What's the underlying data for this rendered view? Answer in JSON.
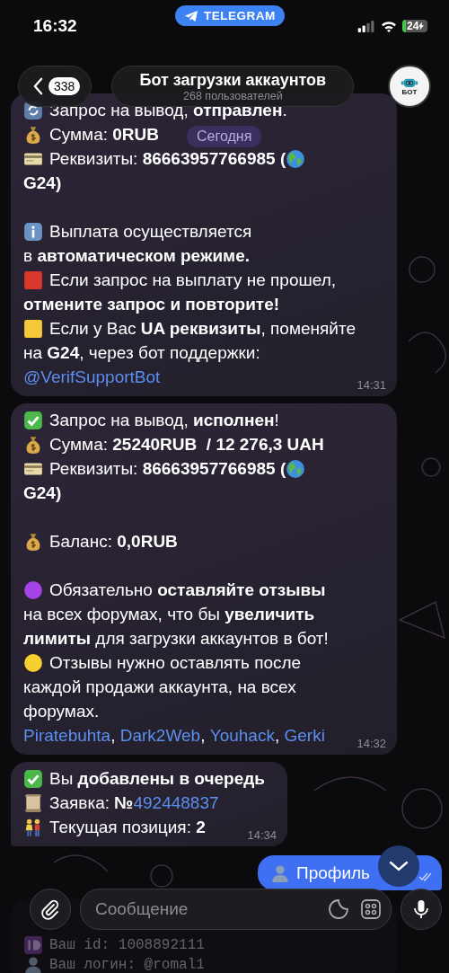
{
  "status_bar": {
    "time": "16:32",
    "app_pill": "TELEGRAM",
    "battery": "24"
  },
  "header": {
    "back_count": "338",
    "title": "Бот загрузки аккаунтов",
    "subtitle": "268 пользователей",
    "avatar_label": "БОТ"
  },
  "date_pill": "Сегодня",
  "messages": [
    {
      "kind": "incoming",
      "time": "14:31",
      "rows": [
        {
          "kind": "sync",
          "parts": [
            {
              "kind": "text",
              "text": "Запрос на вывод, **отправлен**."
            }
          ]
        },
        {
          "kind": "money",
          "parts": [
            {
              "kind": "text",
              "text": "Сумма: **0RUB**"
            }
          ]
        },
        {
          "kind": "card",
          "parts": [
            {
              "kind": "text",
              "text": "Реквизиты: **86663957766985 (**"
            },
            {
              "kind": "globe"
            }
          ]
        },
        {
          "parts": [
            {
              "kind": "text",
              "text": "**G24)**"
            }
          ]
        },
        {
          "kind": "info",
          "spaced": true,
          "parts": [
            {
              "kind": "text",
              "text": "Выплата осуществляется"
            }
          ]
        },
        {
          "parts": [
            {
              "kind": "text",
              "text": "в **автоматическом режиме.**"
            }
          ]
        },
        {
          "kind": "red-square",
          "parts": [
            {
              "kind": "text",
              "text": "Если запрос на выплату не прошел,"
            }
          ]
        },
        {
          "parts": [
            {
              "kind": "text",
              "text": "**отмените запрос и повторите!**"
            }
          ]
        },
        {
          "kind": "yellow-square",
          "parts": [
            {
              "kind": "text",
              "text": "Если у Вас **UA реквизиты**, поменяйте"
            }
          ]
        },
        {
          "parts": [
            {
              "kind": "text",
              "text": "на **G24**, через бот поддержки:"
            }
          ]
        },
        {
          "parts": [
            {
              "kind": "link",
              "text": "@VerifSupportBot"
            }
          ]
        }
      ]
    },
    {
      "kind": "incoming",
      "time": "14:32",
      "rows": [
        {
          "kind": "check",
          "parts": [
            {
              "kind": "text",
              "text": "Запрос на вывод, **исполнен**!"
            }
          ]
        },
        {
          "kind": "money",
          "parts": [
            {
              "kind": "text",
              "text": "Сумма: **25240RUB  / 12 276,3 UAH**"
            }
          ]
        },
        {
          "kind": "card",
          "parts": [
            {
              "kind": "text",
              "text": "Реквизиты: **86663957766985 (**"
            },
            {
              "kind": "globe"
            }
          ]
        },
        {
          "parts": [
            {
              "kind": "text",
              "text": "**G24)**"
            }
          ]
        },
        {
          "kind": "money",
          "spaced": true,
          "parts": [
            {
              "kind": "text",
              "text": "Баланс: **0,0RUB**"
            }
          ]
        },
        {
          "kind": "purple-circle",
          "spaced": true,
          "parts": [
            {
              "kind": "text",
              "text": "Обязательно **оставляйте отзывы**"
            }
          ]
        },
        {
          "parts": [
            {
              "kind": "text",
              "text": "на всех форумах, что бы **увеличить**"
            }
          ]
        },
        {
          "parts": [
            {
              "kind": "text",
              "text": "**лимиты** для загрузки аккаунтов в бот!"
            }
          ]
        },
        {
          "kind": "yellow-circle",
          "parts": [
            {
              "kind": "text",
              "text": "Отзывы нужно оставлять после"
            }
          ]
        },
        {
          "parts": [
            {
              "kind": "text",
              "text": "каждой продажи аккаунта, на всех"
            }
          ]
        },
        {
          "parts": [
            {
              "kind": "text",
              "text": "форумах."
            }
          ]
        },
        {
          "parts": [
            {
              "kind": "link",
              "text": "Piratebuhta"
            },
            {
              "kind": "text",
              "text": ", "
            },
            {
              "kind": "link",
              "text": "Dark2Web"
            },
            {
              "kind": "text",
              "text": ", "
            },
            {
              "kind": "link",
              "text": "Youhack"
            },
            {
              "kind": "text",
              "text": ", "
            },
            {
              "kind": "link",
              "text": "Gerki"
            }
          ]
        }
      ]
    },
    {
      "kind": "incoming",
      "time": "14:34",
      "tail": true,
      "rows": [
        {
          "kind": "check",
          "parts": [
            {
              "kind": "text",
              "text": "Вы **добавлены в очередь**"
            }
          ]
        },
        {
          "kind": "scroll",
          "parts": [
            {
              "kind": "text",
              "text": "Заявка: **№**"
            },
            {
              "kind": "link",
              "text": "492448837"
            }
          ]
        },
        {
          "kind": "couple",
          "parts": [
            {
              "kind": "text",
              "text": "Текущая позиция: **2**"
            }
          ]
        }
      ]
    },
    {
      "kind": "outgoing",
      "rows": [
        {
          "kind": "person",
          "parts": [
            {
              "kind": "text",
              "text": "Профиль"
            }
          ]
        }
      ]
    },
    {
      "kind": "faded",
      "rows": [
        {
          "kind": "id",
          "parts": [
            {
              "kind": "text",
              "text": "Ваш id: 1008892111"
            }
          ]
        },
        {
          "kind": "person",
          "parts": [
            {
              "kind": "text",
              "text": "Ваш логин: @romal1"
            }
          ]
        }
      ]
    }
  ],
  "composer": {
    "placeholder": "Сообщение"
  }
}
